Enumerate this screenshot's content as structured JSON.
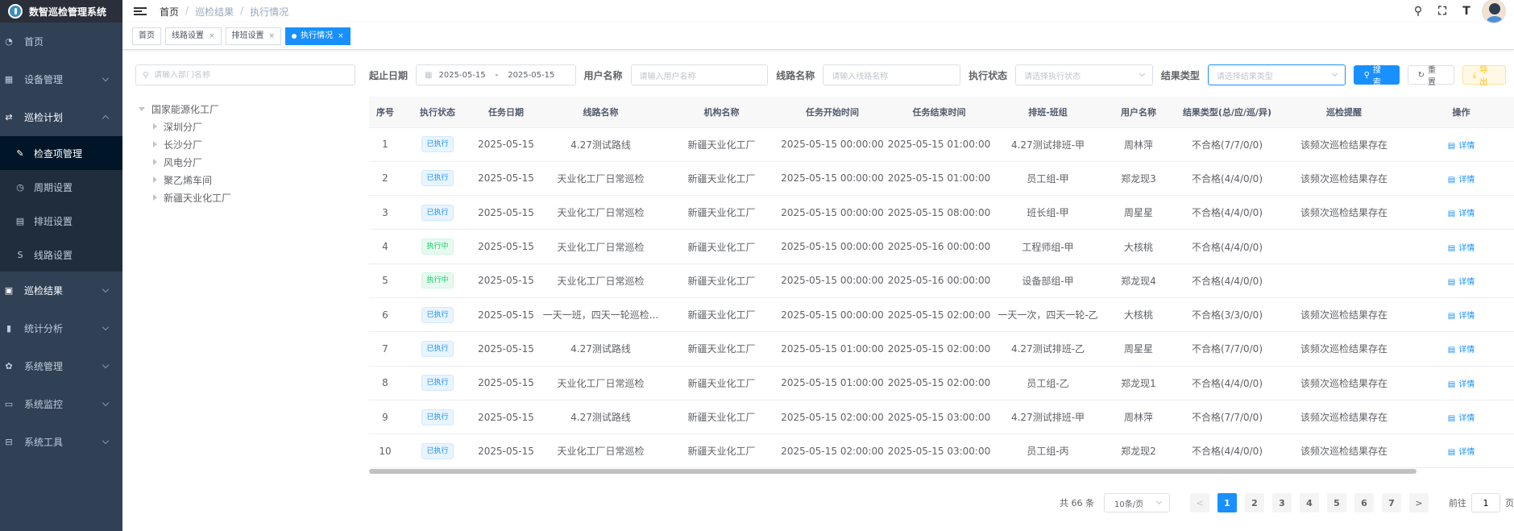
{
  "app": {
    "title": "数智巡检管理系统"
  },
  "sidebar": {
    "items": [
      {
        "label": "首页",
        "icon": "dashboard-icon"
      },
      {
        "label": "设备管理",
        "icon": "grid-icon"
      },
      {
        "label": "巡检计划",
        "icon": "plan-icon"
      },
      {
        "label": "巡检结果",
        "icon": "result-icon"
      },
      {
        "label": "统计分析",
        "icon": "chart-icon"
      },
      {
        "label": "系统管理",
        "icon": "gear-icon"
      },
      {
        "label": "系统监控",
        "icon": "monitor-icon"
      },
      {
        "label": "系统工具",
        "icon": "tool-icon"
      }
    ],
    "sub_items": [
      {
        "label": "检查项管理"
      },
      {
        "label": "周期设置"
      },
      {
        "label": "排班设置"
      },
      {
        "label": "线路设置"
      }
    ]
  },
  "breadcrumb": [
    "首页",
    "巡检结果",
    "执行情况"
  ],
  "tags": [
    "首页",
    "线路设置",
    "排班设置",
    "执行情况"
  ],
  "tree": {
    "search_placeholder": "请输入部门名称",
    "root": "国家能源化工厂",
    "children": [
      "深圳分厂",
      "长沙分厂",
      "风电分厂",
      "聚乙烯车间",
      "新疆天业化工厂"
    ]
  },
  "filters": {
    "date_label": "起止日期",
    "date_start": "2025-05-15",
    "date_sep": "-",
    "date_end": "2025-05-15",
    "user_label": "用户名称",
    "user_placeholder": "请输入用户名称",
    "route_label": "线路名称",
    "route_placeholder": "请输入线路名称",
    "status_label": "执行状态",
    "status_placeholder": "请选择执行状态",
    "result_label": "结果类型",
    "result_placeholder": "请选择结果类型",
    "search_btn": "搜索",
    "reset_btn": "重置",
    "export_btn": "导出"
  },
  "table": {
    "headers": [
      "序号",
      "执行状态",
      "任务日期",
      "线路名称",
      "机构名称",
      "任务开始时间",
      "任务结束时间",
      "排班-班组",
      "用户名称",
      "结果类型(总/应/巡/异)",
      "巡检提醒",
      "操作"
    ],
    "detail_label": "详情",
    "rows": [
      [
        "1",
        "已执行",
        "2025-05-15",
        "4.27测试路线",
        "新疆天业化工厂",
        "2025-05-15 00:00:00",
        "2025-05-15 01:00:00",
        "4.27测试排班-甲",
        "周林萍",
        "不合格(7/7/0/0)",
        "该频次巡检结果存在"
      ],
      [
        "2",
        "已执行",
        "2025-05-15",
        "天业化工厂日常巡检",
        "新疆天业化工厂",
        "2025-05-15 00:00:00",
        "2025-05-15 01:00:00",
        "员工组-甲",
        "郑龙现3",
        "不合格(4/4/0/0)",
        "该频次巡检结果存在"
      ],
      [
        "3",
        "已执行",
        "2025-05-15",
        "天业化工厂日常巡检",
        "新疆天业化工厂",
        "2025-05-15 00:00:00",
        "2025-05-15 08:00:00",
        "班长组-甲",
        "周星星",
        "不合格(4/4/0/0)",
        "该频次巡检结果存在"
      ],
      [
        "4",
        "执行中",
        "2025-05-15",
        "天业化工厂日常巡检",
        "新疆天业化工厂",
        "2025-05-15 00:00:00",
        "2025-05-16 00:00:00",
        "工程师组-甲",
        "大核桃",
        "不合格(4/4/0/0)",
        ""
      ],
      [
        "5",
        "执行中",
        "2025-05-15",
        "天业化工厂日常巡检",
        "新疆天业化工厂",
        "2025-05-15 00:00:00",
        "2025-05-16 00:00:00",
        "设备部组-甲",
        "郑龙现4",
        "不合格(4/4/0/0)",
        ""
      ],
      [
        "6",
        "已执行",
        "2025-05-15",
        "一天一班，四天一轮巡检...",
        "新疆天业化工厂",
        "2025-05-15 00:00:00",
        "2025-05-15 02:00:00",
        "一天一次，四天一轮-乙",
        "大核桃",
        "不合格(3/3/0/0)",
        "该频次巡检结果存在"
      ],
      [
        "7",
        "已执行",
        "2025-05-15",
        "4.27测试路线",
        "新疆天业化工厂",
        "2025-05-15 01:00:00",
        "2025-05-15 02:00:00",
        "4.27测试排班-乙",
        "周星星",
        "不合格(7/7/0/0)",
        "该频次巡检结果存在"
      ],
      [
        "8",
        "已执行",
        "2025-05-15",
        "天业化工厂日常巡检",
        "新疆天业化工厂",
        "2025-05-15 01:00:00",
        "2025-05-15 02:00:00",
        "员工组-乙",
        "郑龙现1",
        "不合格(4/4/0/0)",
        "该频次巡检结果存在"
      ],
      [
        "9",
        "已执行",
        "2025-05-15",
        "4.27测试路线",
        "新疆天业化工厂",
        "2025-05-15 02:00:00",
        "2025-05-15 03:00:00",
        "4.27测试排班-甲",
        "周林萍",
        "不合格(7/7/0/0)",
        "该频次巡检结果存在"
      ],
      [
        "10",
        "已执行",
        "2025-05-15",
        "天业化工厂日常巡检",
        "新疆天业化工厂",
        "2025-05-15 02:00:00",
        "2025-05-15 03:00:00",
        "员工组-丙",
        "郑龙现2",
        "不合格(4/4/0/0)",
        "该频次巡检结果存在"
      ]
    ]
  },
  "pagination": {
    "total": "共 66 条",
    "page_size": "10条/页",
    "prev": "<",
    "next": ">",
    "pages": [
      "1",
      "2",
      "3",
      "4",
      "5",
      "6",
      "7"
    ],
    "current": "1",
    "goto_label": "前往",
    "goto_value": "1",
    "goto_suffix": "页"
  },
  "colors": {
    "sidebar_bg": "#304156",
    "primary": "#1890ff",
    "success": "#13ce66",
    "warning": "#ffba00"
  }
}
